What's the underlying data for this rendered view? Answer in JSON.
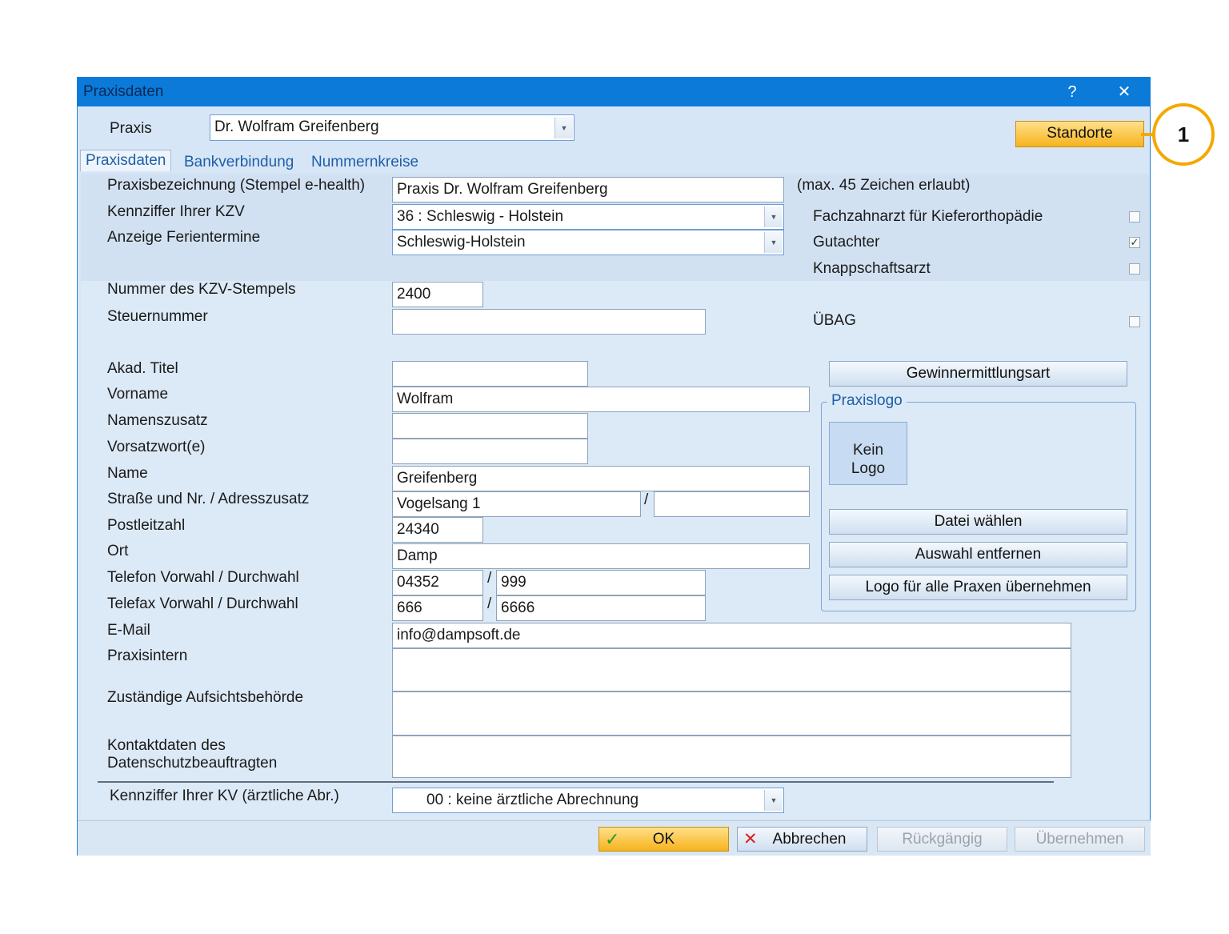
{
  "window": {
    "title": "Praxisdaten",
    "help": "?",
    "close": "✕"
  },
  "praxis": {
    "label": "Praxis",
    "value": "Dr. Wolfram Greifenberg"
  },
  "standorte_button": "Standorte",
  "callout_number": "1",
  "tabs": [
    "Praxisdaten",
    "Bankverbindung",
    "Nummernkreise"
  ],
  "fields": {
    "praxisbezeichnung": {
      "label": "Praxisbezeichnung (Stempel e-health)",
      "value": "Praxis Dr. Wolfram Greifenberg"
    },
    "max_hint": "(max. 45 Zeichen erlaubt)",
    "kzv": {
      "label": "Kennziffer Ihrer KZV",
      "value": "36 : Schleswig - Holstein"
    },
    "ferien": {
      "label": "Anzeige Ferientermine",
      "value": "Schleswig-Holstein"
    },
    "stempel": {
      "label": "Nummer des KZV-Stempels",
      "value": "2400"
    },
    "steuer": {
      "label": "Steuernummer",
      "value": ""
    },
    "titel": {
      "label": "Akad. Titel",
      "value": ""
    },
    "vorname": {
      "label": "Vorname",
      "value": "Wolfram"
    },
    "namenszusatz": {
      "label": "Namenszusatz",
      "value": ""
    },
    "vorsatzwort": {
      "label": "Vorsatzwort(e)",
      "value": ""
    },
    "name": {
      "label": "Name",
      "value": "Greifenberg"
    },
    "strasse": {
      "label": "Straße und Nr. / Adresszusatz",
      "value": "Vogelsang 1",
      "zusatz": ""
    },
    "plz": {
      "label": "Postleitzahl",
      "value": "24340"
    },
    "ort": {
      "label": "Ort",
      "value": "Damp"
    },
    "telefon": {
      "label": "Telefon Vorwahl / Durchwahl",
      "vorwahl": "04352",
      "durchwahl": "999"
    },
    "telefax": {
      "label": "Telefax Vorwahl / Durchwahl",
      "vorwahl": "666",
      "durchwahl": "6666"
    },
    "email": {
      "label": "E-Mail",
      "value": "info@dampsoft.de"
    },
    "praxisintern": {
      "label": "Praxisintern",
      "value": ""
    },
    "aufsicht": {
      "label": "Zuständige Aufsichtsbehörde",
      "value": ""
    },
    "datenschutz": {
      "label_line1": "Kontaktdaten des",
      "label_line2": "Datenschutzbeauftragten",
      "value": ""
    },
    "kv": {
      "label": "Kennziffer Ihrer KV (ärztliche Abr.)",
      "value": "00 : keine ärztliche Abrechnung"
    },
    "slash": "/"
  },
  "checkboxes": [
    {
      "label": "Fachzahnarzt für Kieferorthopädie",
      "checked": false
    },
    {
      "label": "Gutachter",
      "checked": true
    },
    {
      "label": "Knappschaftsarzt",
      "checked": false
    },
    {
      "label": "ÜBAG",
      "checked": false
    }
  ],
  "check_glyph": "✓",
  "gewinn_button": "Gewinnermittlungsart",
  "logo": {
    "group_title": "Praxislogo",
    "placeholder_line1": "Kein",
    "placeholder_line2": "Logo",
    "buttons": [
      "Datei wählen",
      "Auswahl entfernen",
      "Logo für alle Praxen übernehmen"
    ]
  },
  "footer": {
    "ok": "OK",
    "ok_icon": "✓",
    "cancel": "Abbrechen",
    "cancel_icon": "✕",
    "undo": "Rückgängig",
    "apply": "Übernehmen"
  },
  "colors": {
    "titlebar": "#0b7ad9",
    "accent_orange": "#f7b31d",
    "callout": "#f5a800"
  }
}
